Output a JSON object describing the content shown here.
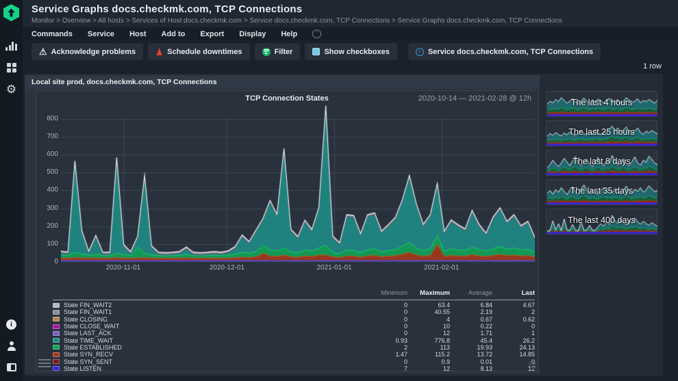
{
  "header": {
    "title": "Service Graphs docs.checkmk.com, TCP Connections",
    "breadcrumb": "Monitor > Overview > All hosts > Services of Host docs.checkmk.com > Service docs.checkmk.com, TCP Connections > Service Graphs docs.checkmk.com, TCP Connections"
  },
  "menubar": {
    "items": [
      "Commands",
      "Service",
      "Host",
      "Add to",
      "Export",
      "Display",
      "Help"
    ]
  },
  "toolbar": {
    "buttons": [
      {
        "label": "Acknowledge problems",
        "icon": "warning-icon"
      },
      {
        "label": "Schedule downtimes",
        "icon": "downtime-cone-icon"
      },
      {
        "label": "Filter",
        "icon": "filter-icon"
      },
      {
        "label": "Show checkboxes",
        "icon": "checkbox-icon"
      },
      {
        "label": "Service docs.checkmk.com, TCP Connections",
        "icon": "service-link-icon"
      }
    ]
  },
  "status": {
    "row_count": "1 row"
  },
  "panel": {
    "title": "Local site prod, docs.checkmk.com, TCP Connections"
  },
  "chart_data": {
    "type": "area",
    "title": "TCP Connection States",
    "range_label": "2020-10-14 — 2021-02-28 @ 12h",
    "ylim": [
      0,
      880
    ],
    "y_ticks": [
      0,
      100,
      200,
      300,
      400,
      500,
      600,
      700,
      800
    ],
    "days_span": 137,
    "sample_step_days": 2,
    "x_ticks": [
      {
        "label": "2020-11-01",
        "day": 18
      },
      {
        "label": "2020-12-01",
        "day": 48
      },
      {
        "label": "2021-01-01",
        "day": 79
      },
      {
        "label": "2021-02-01",
        "day": 110
      }
    ],
    "legend_position": "bottom-table",
    "grid": true,
    "outline_color": "#e9e9ee",
    "series": [
      {
        "name": "State LISTEN",
        "color": "#3a23d6",
        "constant": 8
      },
      {
        "name": "State SYN_SENT",
        "color": "#7a1822",
        "constant": 0.3
      },
      {
        "name": "State SYN_RECV",
        "color": "#a33a18",
        "values": [
          13,
          12,
          16,
          14,
          13,
          14,
          12,
          12,
          15,
          13,
          12,
          14,
          15,
          13,
          12,
          12,
          12,
          13,
          14,
          12,
          12,
          12,
          13,
          12,
          13,
          15,
          18,
          16,
          20,
          40,
          25,
          22,
          30,
          20,
          18,
          25,
          22,
          30,
          30,
          20,
          16,
          25,
          24,
          18,
          25,
          28,
          20,
          24,
          26,
          35,
          45,
          30,
          24,
          28,
          90,
          22,
          28,
          25,
          24,
          32,
          26,
          22,
          28,
          34,
          27,
          30,
          25,
          27,
          20
        ]
      },
      {
        "name": "State ESTABLISHED",
        "color": "#11a458",
        "values": [
          18,
          16,
          30,
          22,
          17,
          20,
          16,
          15,
          25,
          20,
          16,
          60,
          25,
          18,
          15,
          14,
          15,
          16,
          20,
          15,
          14,
          15,
          16,
          15,
          18,
          22,
          28,
          24,
          30,
          45,
          35,
          30,
          40,
          28,
          25,
          35,
          30,
          40,
          55,
          25,
          22,
          35,
          32,
          26,
          35,
          38,
          28,
          32,
          35,
          45,
          55,
          40,
          32,
          38,
          50,
          30,
          38,
          34,
          32,
          42,
          35,
          30,
          38,
          45,
          36,
          40,
          34,
          36,
          28
        ]
      },
      {
        "name": "State TIME_WAIT",
        "color": "#1f8c85",
        "values": [
          10,
          8,
          500,
          120,
          10,
          95,
          8,
          8,
          525,
          45,
          10,
          50,
          425,
          40,
          8,
          6,
          8,
          10,
          30,
          8,
          6,
          8,
          10,
          8,
          12,
          30,
          85,
          55,
          110,
          140,
          265,
          195,
          545,
          115,
          80,
          155,
          110,
          215,
          770,
          80,
          50,
          185,
          185,
          95,
          185,
          190,
          105,
          135,
          170,
          250,
          365,
          235,
          135,
          180,
          280,
          100,
          150,
          130,
          110,
          195,
          130,
          90,
          165,
          205,
          145,
          175,
          125,
          145,
          70
        ]
      },
      {
        "name": "State LAST_ACK",
        "color": "#7a5fc0",
        "constant": 1.7
      },
      {
        "name": "State CLOSE_WAIT",
        "color": "#a317a3",
        "constant": 0.2
      },
      {
        "name": "State CLOSING",
        "color": "#b3854f",
        "constant": 0.7
      },
      {
        "name": "State FIN_WAIT1",
        "color": "#888d94",
        "constant": 2.2
      },
      {
        "name": "State FIN_WAIT2",
        "color": "#b5b8bd",
        "constant": 6.8
      }
    ]
  },
  "legend": {
    "headers": [
      "Minimum",
      "Maximum",
      "Average",
      "Last"
    ],
    "rows": [
      {
        "label": "State FIN_WAIT2",
        "color": "#b5b8bd",
        "min": "0",
        "max": "63.4",
        "avg": "6.84",
        "last": "4.67"
      },
      {
        "label": "State FIN_WAIT1",
        "color": "#888d94",
        "min": "0",
        "max": "40.55",
        "avg": "2.19",
        "last": "2"
      },
      {
        "label": "State CLOSING",
        "color": "#b3854f",
        "min": "0",
        "max": "4",
        "avg": "0.67",
        "last": "0.62"
      },
      {
        "label": "State CLOSE_WAIT",
        "color": "#a317a3",
        "min": "0",
        "max": "10",
        "avg": "0.22",
        "last": "0"
      },
      {
        "label": "State LAST_ACK",
        "color": "#7a5fc0",
        "min": "0",
        "max": "12",
        "avg": "1.71",
        "last": "1"
      },
      {
        "label": "State TIME_WAIT",
        "color": "#1f8c85",
        "min": "0.93",
        "max": "776.8",
        "avg": "45.4",
        "last": "26.2"
      },
      {
        "label": "State ESTABLISHED",
        "color": "#11a458",
        "min": "2",
        "max": "113",
        "avg": "19.93",
        "last": "24.13"
      },
      {
        "label": "State SYN_RECV",
        "color": "#a33a18",
        "min": "1.47",
        "max": "115.2",
        "avg": "13.72",
        "last": "14.85"
      },
      {
        "label": "State SYN_SENT",
        "color": "#7a1822",
        "min": "0",
        "max": "0.9",
        "avg": "0.01",
        "last": "0"
      },
      {
        "label": "State LISTEN",
        "color": "#3a23d6",
        "min": "7",
        "max": "12",
        "avg": "8.13",
        "last": "12"
      }
    ]
  },
  "minigraphs": [
    {
      "label": "The last 4 hours",
      "values": [
        55,
        70,
        62,
        80,
        68,
        90,
        75,
        60,
        72,
        85,
        66,
        58,
        74,
        88,
        70,
        62,
        78,
        68,
        82,
        72,
        60,
        76,
        86,
        64,
        70,
        80,
        58,
        72,
        90,
        76,
        64,
        70,
        84,
        62,
        74,
        68,
        80,
        70,
        60,
        75
      ]
    },
    {
      "label": "The last 25 hours",
      "values": [
        40,
        55,
        45,
        60,
        50,
        42,
        58,
        48,
        65,
        52,
        44,
        60,
        70,
        55,
        46,
        62,
        52,
        75,
        58,
        48,
        66,
        56,
        80,
        95,
        70,
        85,
        60,
        75,
        90,
        65,
        55,
        70,
        85,
        60,
        50,
        68,
        58,
        72,
        62,
        52
      ]
    },
    {
      "label": "The last 8 days",
      "values": [
        30,
        45,
        70,
        50,
        35,
        55,
        80,
        60,
        40,
        65,
        90,
        55,
        38,
        58,
        75,
        48,
        35,
        60,
        85,
        50,
        40,
        68,
        55,
        95,
        65,
        42,
        58,
        78,
        50,
        38,
        62,
        88,
        55,
        42,
        70,
        58,
        92,
        75,
        55,
        45
      ]
    },
    {
      "label": "The last 35 days",
      "values": [
        50,
        65,
        45,
        70,
        55,
        80,
        60,
        42,
        68,
        85,
        55,
        45,
        75,
        95,
        65,
        50,
        70,
        55,
        42,
        65,
        80,
        55,
        68,
        50,
        75,
        60,
        45,
        70,
        88,
        58,
        48,
        72,
        60,
        80,
        55,
        68,
        90,
        75,
        58,
        65
      ]
    },
    {
      "label": "The last 400 days",
      "values": [
        5,
        8,
        60,
        10,
        45,
        8,
        70,
        12,
        8,
        40,
        10,
        6,
        55,
        8,
        12,
        35,
        8,
        10,
        28,
        45,
        30,
        55,
        40,
        90,
        60,
        45,
        70,
        50,
        38,
        62,
        48,
        75,
        55,
        42,
        58,
        45,
        35,
        50,
        40,
        30
      ]
    }
  ]
}
